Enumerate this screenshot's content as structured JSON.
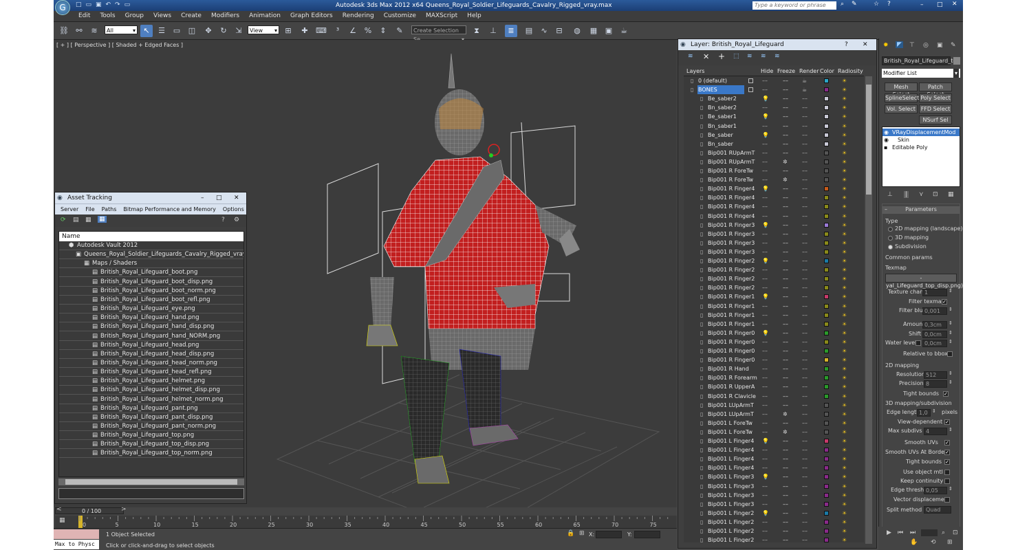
{
  "app": {
    "title": "Autodesk 3ds Max  2012 x64     Queens_Royal_Soldier_Lifeguards_Cavalry_Rigged_vray.max",
    "search_placeholder": "Type a keyword or phrase"
  },
  "menu": [
    "Edit",
    "Tools",
    "Group",
    "Views",
    "Create",
    "Modifiers",
    "Animation",
    "Graph Editors",
    "Rendering",
    "Customize",
    "MAXScript",
    "Help"
  ],
  "toolbar": {
    "selection_filter": "All",
    "ref_coord": "View",
    "named_selection": "Create Selection Se"
  },
  "viewport": {
    "label": "[ + ] [ Perspective ] [ Shaded + Edged Faces ]"
  },
  "asset_tracking": {
    "title": "Asset Tracking",
    "menu": [
      "Server",
      "File",
      "Paths",
      "Bitmap Performance and Memory",
      "Options"
    ],
    "column": "Name",
    "vault": "Autodesk Vault 2012",
    "file": "Queens_Royal_Soldier_Lifeguards_Cavalry_Rigged_vray.max",
    "maps_folder": "Maps / Shaders",
    "maps": [
      "British_Royal_Lifeguard_boot.png",
      "British_Royal_Lifeguard_boot_disp.png",
      "British_Royal_Lifeguard_boot_norm.png",
      "British_Royal_Lifeguard_boot_refl.png",
      "British_Royal_Lifeguard_eye.png",
      "British_Royal_Lifeguard_hand.png",
      "British_Royal_Lifeguard_hand_disp.png",
      "British_Royal_Lifeguard_hand_NORM.png",
      "British_Royal_Lifeguard_head.png",
      "British_Royal_Lifeguard_head_disp.png",
      "British_Royal_Lifeguard_head_norm.png",
      "British_Royal_Lifeguard_head_refl.png",
      "British_Royal_Lifeguard_helmet.png",
      "British_Royal_Lifeguard_helmet_disp.png",
      "British_Royal_Lifeguard_helmet_norm.png",
      "British_Royal_Lifeguard_pant.png",
      "British_Royal_Lifeguard_pant_disp.png",
      "British_Royal_Lifeguard_pant_norm.png",
      "British_Royal_Lifeguard_top.png",
      "British_Royal_Lifeguard_top_disp.png",
      "British_Royal_Lifeguard_top_norm.png"
    ]
  },
  "layer_panel": {
    "title": "Layer: British_Royal_Lifeguard",
    "columns": [
      "Layers",
      "Hide",
      "Freeze",
      "Render",
      "Color",
      "Radiosity"
    ],
    "layers": [
      {
        "name": "0 (default)",
        "color": "#2aa6c8",
        "light": false,
        "snow": false,
        "sel": false
      },
      {
        "name": "BONES",
        "color": "#8a2a8a",
        "light": false,
        "snow": false,
        "sel": true
      },
      {
        "name": "Be_saber2",
        "color": "#c9c9d6",
        "light": true,
        "snow": false,
        "sel": false
      },
      {
        "name": "Bn_saber2",
        "color": "#c9c9d6",
        "light": false,
        "snow": false,
        "sel": false
      },
      {
        "name": "Be_saber1",
        "color": "#c9c9d6",
        "light": true,
        "snow": false,
        "sel": false
      },
      {
        "name": "Bn_saber1",
        "color": "#c9c9d6",
        "light": false,
        "snow": false,
        "sel": false
      },
      {
        "name": "Be_saber",
        "color": "#c9c9d6",
        "light": true,
        "snow": false,
        "sel": false
      },
      {
        "name": "Bn_saber",
        "color": "#c9c9d6",
        "light": false,
        "snow": false,
        "sel": false
      },
      {
        "name": "Bip001 RUpArmT",
        "color": "#555555",
        "light": false,
        "snow": false,
        "sel": false
      },
      {
        "name": "Bip001 RUpArmT",
        "color": "#555555",
        "light": false,
        "snow": true,
        "sel": false
      },
      {
        "name": "Bip001 R ForeTw",
        "color": "#555555",
        "light": false,
        "snow": false,
        "sel": false
      },
      {
        "name": "Bip001 R ForeTw",
        "color": "#555555",
        "light": false,
        "snow": true,
        "sel": false
      },
      {
        "name": "Bip001 R Finger4",
        "color": "#c85a1a",
        "light": true,
        "snow": false,
        "sel": false
      },
      {
        "name": "Bip001 R Finger4",
        "color": "#8a8a1a",
        "light": false,
        "snow": false,
        "sel": false
      },
      {
        "name": "Bip001 R Finger4",
        "color": "#8a8a1a",
        "light": false,
        "snow": false,
        "sel": false
      },
      {
        "name": "Bip001 R Finger4",
        "color": "#8a8a1a",
        "light": false,
        "snow": false,
        "sel": false
      },
      {
        "name": "Bip001 R Finger3",
        "color": "#9a7ad6",
        "light": true,
        "snow": false,
        "sel": false
      },
      {
        "name": "Bip001 R Finger3",
        "color": "#8a8a1a",
        "light": false,
        "snow": false,
        "sel": false
      },
      {
        "name": "Bip001 R Finger3",
        "color": "#8a8a1a",
        "light": false,
        "snow": false,
        "sel": false
      },
      {
        "name": "Bip001 R Finger3",
        "color": "#8a8a1a",
        "light": false,
        "snow": false,
        "sel": false
      },
      {
        "name": "Bip001 R Finger2",
        "color": "#1a7aa6",
        "light": true,
        "snow": false,
        "sel": false
      },
      {
        "name": "Bip001 R Finger2",
        "color": "#8a8a1a",
        "light": false,
        "snow": false,
        "sel": false
      },
      {
        "name": "Bip001 R Finger2",
        "color": "#8a8a1a",
        "light": false,
        "snow": false,
        "sel": false
      },
      {
        "name": "Bip001 R Finger2",
        "color": "#8a8a1a",
        "light": false,
        "snow": false,
        "sel": false
      },
      {
        "name": "Bip001 R Finger1",
        "color": "#c83a6a",
        "light": true,
        "snow": false,
        "sel": false
      },
      {
        "name": "Bip001 R Finger1",
        "color": "#8a8a1a",
        "light": false,
        "snow": false,
        "sel": false
      },
      {
        "name": "Bip001 R Finger1",
        "color": "#8a8a1a",
        "light": false,
        "snow": false,
        "sel": false
      },
      {
        "name": "Bip001 R Finger1",
        "color": "#8a8a1a",
        "light": false,
        "snow": false,
        "sel": false
      },
      {
        "name": "Bip001 R Finger0",
        "color": "#2a9a2a",
        "light": true,
        "snow": false,
        "sel": false
      },
      {
        "name": "Bip001 R Finger0",
        "color": "#8a8a1a",
        "light": false,
        "snow": false,
        "sel": false
      },
      {
        "name": "Bip001 R Finger0",
        "color": "#2a9a2a",
        "light": false,
        "snow": false,
        "sel": false
      },
      {
        "name": "Bip001 R Finger0",
        "color": "#d6b42a",
        "light": false,
        "snow": false,
        "sel": false
      },
      {
        "name": "Bip001 R Hand",
        "color": "#2a9a2a",
        "light": false,
        "snow": false,
        "sel": false
      },
      {
        "name": "Bip001 R Forearm",
        "color": "#2a9a2a",
        "light": false,
        "snow": false,
        "sel": false
      },
      {
        "name": "Bip001 R UpperA",
        "color": "#2a9a2a",
        "light": false,
        "snow": false,
        "sel": false
      },
      {
        "name": "Bip001 R Clavicle",
        "color": "#2a9a2a",
        "light": false,
        "snow": false,
        "sel": false
      },
      {
        "name": "Bip001 LUpArmT",
        "color": "#555555",
        "light": false,
        "snow": false,
        "sel": false
      },
      {
        "name": "Bip001 LUpArmT",
        "color": "#555555",
        "light": false,
        "snow": true,
        "sel": false
      },
      {
        "name": "Bip001 L ForeTw",
        "color": "#555555",
        "light": false,
        "snow": false,
        "sel": false
      },
      {
        "name": "Bip001 L ForeTw",
        "color": "#555555",
        "light": false,
        "snow": true,
        "sel": false
      },
      {
        "name": "Bip001 L Finger4",
        "color": "#c83a6a",
        "light": true,
        "snow": false,
        "sel": false
      },
      {
        "name": "Bip001 L Finger4",
        "color": "#8a2a8a",
        "light": false,
        "snow": false,
        "sel": false
      },
      {
        "name": "Bip001 L Finger4",
        "color": "#8a2a8a",
        "light": false,
        "snow": false,
        "sel": false
      },
      {
        "name": "Bip001 L Finger4",
        "color": "#8a2a8a",
        "light": false,
        "snow": false,
        "sel": false
      },
      {
        "name": "Bip001 L Finger3",
        "color": "#8a2a8a",
        "light": true,
        "snow": false,
        "sel": false
      },
      {
        "name": "Bip001 L Finger3",
        "color": "#8a2a8a",
        "light": false,
        "snow": false,
        "sel": false
      },
      {
        "name": "Bip001 L Finger3",
        "color": "#8a2a8a",
        "light": false,
        "snow": false,
        "sel": false
      },
      {
        "name": "Bip001 L Finger3",
        "color": "#8a2a8a",
        "light": false,
        "snow": false,
        "sel": false
      },
      {
        "name": "Bip001 L Finger2",
        "color": "#1a7aa6",
        "light": true,
        "snow": false,
        "sel": false
      },
      {
        "name": "Bip001 L Finger2",
        "color": "#8a2a8a",
        "light": false,
        "snow": false,
        "sel": false
      },
      {
        "name": "Bip001 L Finger2",
        "color": "#8a2a8a",
        "light": false,
        "snow": false,
        "sel": false
      },
      {
        "name": "Bip001 L Finger2",
        "color": "#8a2a8a",
        "light": false,
        "snow": false,
        "sel": false
      }
    ]
  },
  "command_panel": {
    "object_name": "British_Royal_Lifeguard_top",
    "modifier_list": "Modifier List",
    "buttons": [
      "Mesh Select",
      "Patch Select",
      "SplineSelect",
      "Poly Select",
      "Vol. Select",
      "FFD Select",
      "NSurf Sel"
    ],
    "stack": [
      "VRayDisplacementMod",
      "Skin",
      "Editable Poly"
    ],
    "rollout": "Parameters",
    "type_label": "Type",
    "types": [
      "2D mapping (landscape)",
      "3D mapping",
      "Subdivision"
    ],
    "common_params": "Common params",
    "texmap_label": "Texmap",
    "texmap": "-yal_Lifeguard_top_disp.png)",
    "texture_chan_label": "Texture chan",
    "texture_chan": "1",
    "filter_texmap": "Filter texmap",
    "filter_blur_label": "Filter blur",
    "filter_blur": "0,001",
    "amount_label": "Amount",
    "amount": "0,3cm",
    "shift_label": "Shift",
    "shift": "0,0cm",
    "water_level_label": "Water level",
    "water_level": "0,0cm",
    "relative_bbox": "Relative to bbox",
    "mapping2d": "2D mapping",
    "resolution_label": "Resolution",
    "resolution": "512",
    "precision_label": "Precision",
    "precision": "8",
    "tight_bounds": "Tight bounds",
    "mapping3d": "3D mapping/subdivision",
    "edge_length_label": "Edge length",
    "edge_length": "1,0",
    "pixels": "pixels",
    "view_dependent": "View-dependent",
    "max_subdivs_label": "Max subdivs",
    "max_subdivs": "4",
    "smooth_uvs": "Smooth UVs",
    "smooth_uvs_borders": "Smooth UVs At Borders",
    "tight_bounds2": "Tight bounds",
    "use_object_mtl": "Use object mtl",
    "keep_continuity": "Keep continuity",
    "edge_thresh_label": "Edge thresh",
    "edge_thresh": "0,05",
    "vector_displacement": "Vector displacement",
    "split_method_label": "Split method",
    "split_method": "Quad"
  },
  "timeline": {
    "frame": "0 / 100",
    "ticks": [
      "0",
      "5",
      "10",
      "15",
      "20",
      "25",
      "30",
      "35",
      "40",
      "45",
      "50",
      "55",
      "60",
      "65",
      "70",
      "75"
    ]
  },
  "status": {
    "script_label": "Max to Physc",
    "selected": "1 Object Selected",
    "prompt": "Click or click-and-drag to select objects",
    "x_label": "X:",
    "y_label": "Y:"
  },
  "colors": {
    "title_blue": "#1c3f75",
    "ui_dark": "#444444",
    "viewport": "#3c3c3c",
    "highlight": "#3a78c8"
  }
}
